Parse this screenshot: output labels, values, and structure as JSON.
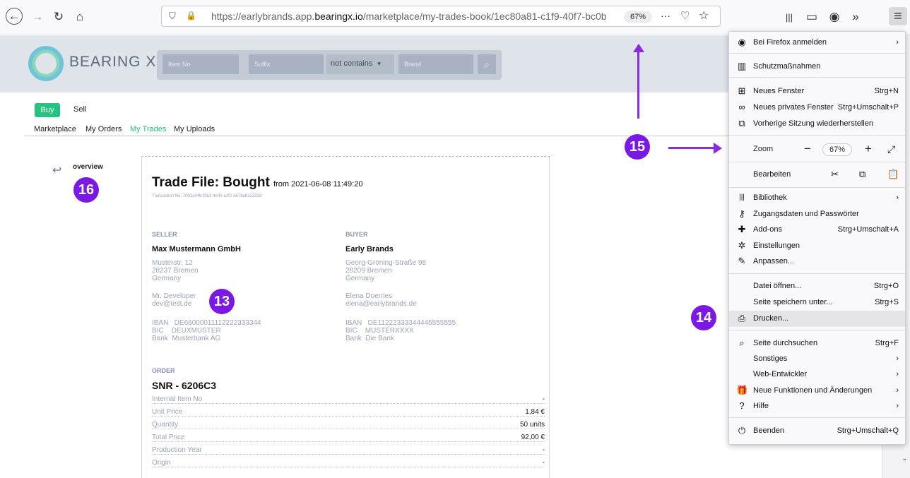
{
  "browser": {
    "url_prefix": "https://earlybrands.app.",
    "url_domain": "bearingx.io",
    "url_path": "/marketplace/my-trades-book/1ec80a81-c1f9-40f7-bc0b-4b",
    "zoom": "67%",
    "icons": {
      "back": "←",
      "forward": "→",
      "reload": "↻",
      "home": "⌂",
      "shield": "⛉",
      "lock": "🔒",
      "more": "···",
      "pocket": "♡",
      "star": "☆",
      "library": "|||",
      "sidebar": "▭",
      "account": "◉",
      "overflow": "»",
      "hamburger": "≡"
    }
  },
  "site": {
    "logo_text": "BEARING X",
    "search": {
      "item_no": "Item No",
      "suffix": "Suffix",
      "filter_value": "not contains",
      "filter_caret": "▾",
      "brand": "Brand",
      "search_icon": "⌕"
    }
  },
  "tabs": {
    "buy": "Buy",
    "sell": "Sell"
  },
  "nav": [
    "Marketplace",
    "My Orders",
    "My Trades",
    "My Uploads"
  ],
  "back": {
    "arrow": "↩",
    "label": "overview"
  },
  "trade": {
    "title": "Trade File:  Bought",
    "from_text": "from 2021-06-08 11:49:20",
    "transaction": "Transaction No: 7001a44b-f381-4e40-a1f2-a678ab12293d",
    "seller": {
      "heading": "SELLER",
      "name": "Max Mustermann GmbH",
      "address": "Musterstr. 12\n28237 Bremen\nGermany",
      "contact": "Mr. Developer\ndev@test.de",
      "bank": "IBAN   DE66000011112222333344\nBIC    DEUXMUSTER\nBank  Musterbank AG"
    },
    "buyer": {
      "heading": "BUYER",
      "name": "Early Brands",
      "address": "Georg-Gröning-Straße 98\n28209 Bremen\nGermany",
      "contact": "Elena Doerries\nelena@earlybrands.de",
      "bank": "IBAN   DE11222333344445555555\nBIC    MUSTERXXXX\nBank  Die Bank"
    },
    "order": {
      "heading": "ORDER",
      "snr": "SNR - 6206C3",
      "rows": [
        {
          "label": "Internal Item No",
          "value": "-"
        },
        {
          "label": "Unit Price",
          "value": "1,84 €"
        },
        {
          "label": "Quantity",
          "value": "50 units"
        },
        {
          "label": "Total Price",
          "value": "92,00 €"
        },
        {
          "label": "Production Year",
          "value": "-"
        },
        {
          "label": "Origin",
          "value": "-"
        }
      ]
    }
  },
  "menu": {
    "items": [
      {
        "icon": "◉",
        "label": "Bei Firefox anmelden",
        "shortcut": "›"
      },
      {
        "icon": "▥",
        "label": "Schutzmaßnahmen",
        "shortcut": ""
      },
      {
        "icon": "⊞",
        "label": "Neues Fenster",
        "shortcut": "Strg+N"
      },
      {
        "icon": "∞",
        "label": "Neues privates Fenster",
        "shortcut": "Strg+Umschalt+P"
      },
      {
        "icon": "⧉",
        "label": "Vorherige Sitzung wiederherstellen",
        "shortcut": ""
      },
      {
        "icon": "|||",
        "label": "Bibliothek",
        "shortcut": "›"
      },
      {
        "icon": "⚷",
        "label": "Zugangsdaten und Passwörter",
        "shortcut": ""
      },
      {
        "icon": "✚",
        "label": "Add-ons",
        "shortcut": "Strg+Umschalt+A"
      },
      {
        "icon": "✲",
        "label": "Einstellungen",
        "shortcut": ""
      },
      {
        "icon": "✎",
        "label": "Anpassen...",
        "shortcut": ""
      },
      {
        "icon": "",
        "label": "Datei öffnen...",
        "shortcut": "Strg+O"
      },
      {
        "icon": "",
        "label": "Seite speichern unter...",
        "shortcut": "Strg+S"
      },
      {
        "icon": "⎙",
        "label": "Drucken...",
        "shortcut": ""
      },
      {
        "icon": "⌕",
        "label": "Seite durchsuchen",
        "shortcut": "Strg+F"
      },
      {
        "icon": "",
        "label": "Sonstiges",
        "shortcut": "›"
      },
      {
        "icon": "",
        "label": "Web-Entwickler",
        "shortcut": "›"
      },
      {
        "icon": "🎁",
        "label": "Neue Funktionen und Änderungen",
        "shortcut": "›"
      },
      {
        "icon": "?",
        "label": "Hilfe",
        "shortcut": "›"
      },
      {
        "icon": "⏻",
        "label": "Beenden",
        "shortcut": "Strg+Umschalt+Q"
      }
    ],
    "zoom_label": "Zoom",
    "zoom_minus": "−",
    "zoom_value": "67%",
    "zoom_plus": "+",
    "zoom_fullscreen": "⤢",
    "edit_label": "Bearbeiten",
    "edit_icons": {
      "cut": "✂",
      "copy": "⧉",
      "paste": "📋"
    }
  },
  "annotations": [
    "13",
    "14",
    "15",
    "16"
  ],
  "colors": {
    "accent_green": "#26c281",
    "annotation_purple": "#7a18e6"
  }
}
